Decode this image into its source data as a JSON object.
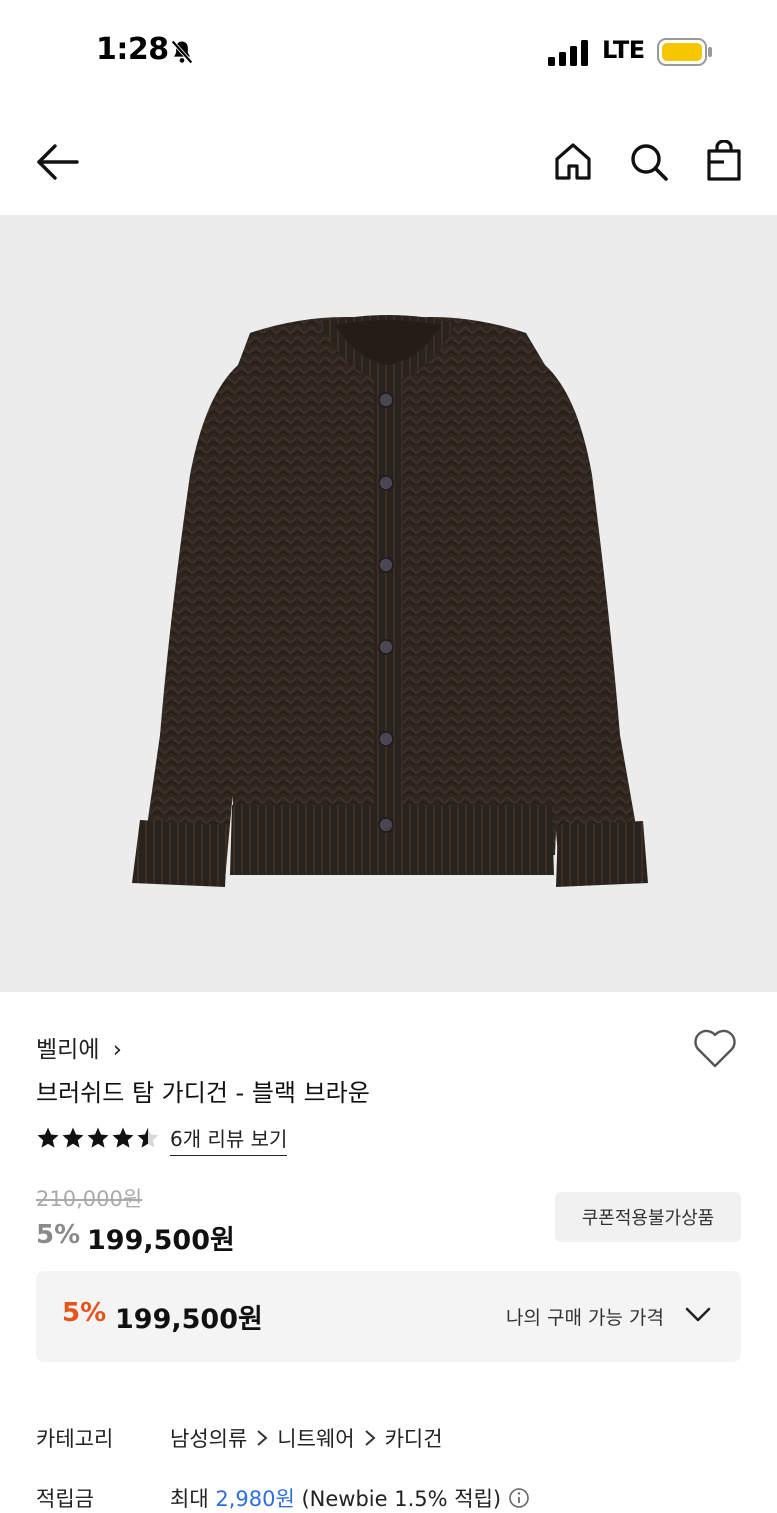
{
  "status_bar": {
    "time": "1:28",
    "network": "LTE",
    "battery_color": "#f6c700"
  },
  "nav": {
    "icons": [
      "back-arrow-icon",
      "home-icon",
      "search-icon",
      "shopping-bag-icon"
    ]
  },
  "product": {
    "image": "cardigan-photo",
    "brand": "벨리에",
    "brand_chevron": "›",
    "name": "브러쉬드 탐 가디건 - 블랙 브라운",
    "rating_stars": 4.5,
    "review_link": "6개 리뷰 보기",
    "original_price": "210,000원",
    "discount": "5%",
    "price": "199,500원",
    "coupon_badge": "쿠폰적용불가상품"
  },
  "my_price": {
    "discount": "5%",
    "price": "199,500원",
    "label": "나의 구매 가능 가격",
    "accent_color": "#e8531c"
  },
  "details": {
    "category_label": "카테고리",
    "category_path": [
      "남성의류",
      "니트웨어",
      "카디건"
    ],
    "points_label": "적립금",
    "points_prefix": "최대",
    "points_amount": "2,980원",
    "points_suffix": "(Newbie 1.5% 적립)"
  }
}
